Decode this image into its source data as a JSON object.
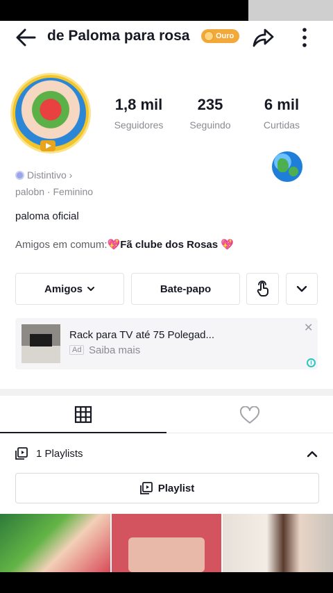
{
  "header": {
    "title": "de Paloma para rosa",
    "badge": "Ouro"
  },
  "stats": [
    {
      "value": "1,8 mil",
      "label": "Seguidores"
    },
    {
      "value": "235",
      "label": "Seguindo"
    },
    {
      "value": "6 mil",
      "label": "Curtidas"
    }
  ],
  "profile": {
    "distintivo": "Distintivo ›",
    "username_line": "palobn  ·  Feminino",
    "bio": "paloma oficial",
    "mutual_prefix": "Amigos em comum:",
    "mutual_names": "Fã clube  dos Rosas"
  },
  "actions": {
    "friends": "Amigos",
    "chat": "Bate-papo"
  },
  "ad": {
    "title": "Rack para TV até 75 Polegad...",
    "tag": "Ad",
    "cta": "Saiba mais"
  },
  "playlists": {
    "count_label": "1 Playlists",
    "button_label": "Playlist"
  },
  "colors": {
    "accent": "#161823",
    "badge": "#f2a93a",
    "muted": "#8a8b91"
  }
}
